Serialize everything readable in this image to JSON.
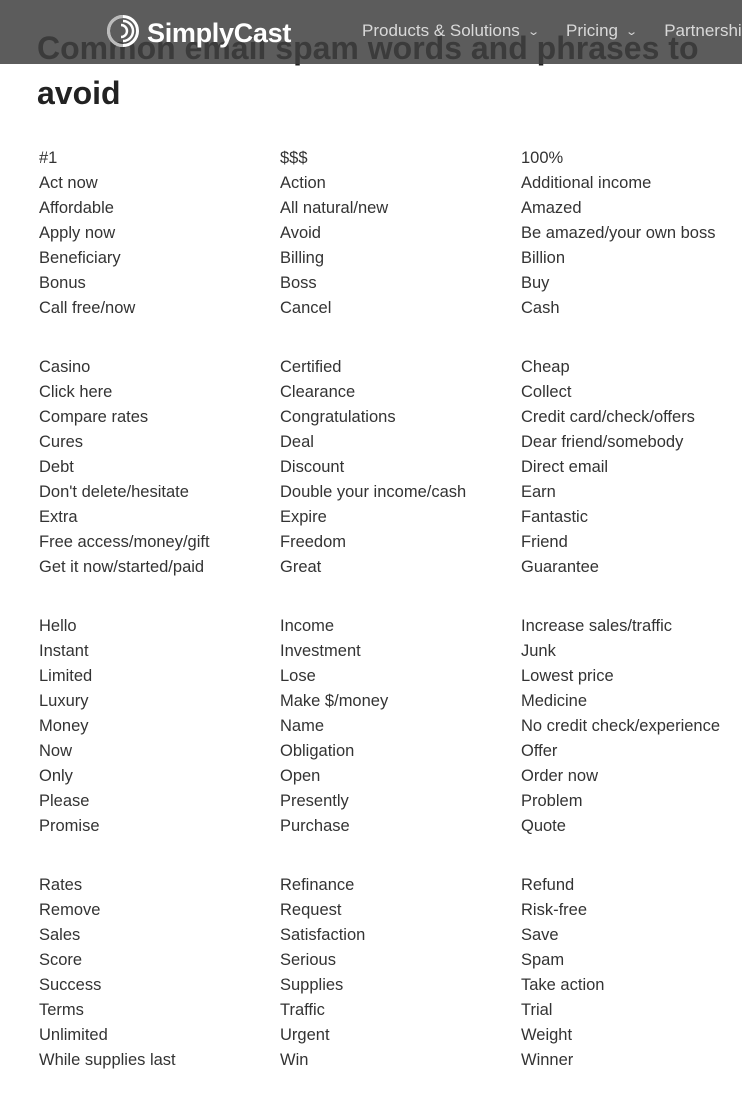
{
  "header": {
    "brand": "SimplyCast",
    "logo_icon": "simplycast-logo-icon",
    "nav": [
      {
        "label": "Products & Solutions",
        "has_dropdown": true
      },
      {
        "label": "Pricing",
        "has_dropdown": true
      },
      {
        "label": "Partnerships",
        "has_dropdown": false
      }
    ],
    "chevron": "⌄"
  },
  "title": "Common email spam words and phrases to avoid",
  "groups": [
    [
      [
        "#1",
        "$$$",
        "100%"
      ],
      [
        "Act now",
        "Action",
        "Additional income"
      ],
      [
        "Affordable",
        "All natural/new",
        "Amazed"
      ],
      [
        "Apply now",
        "Avoid",
        "Be amazed/your own boss"
      ],
      [
        "Beneficiary",
        "Billing",
        "Billion"
      ],
      [
        "Bonus",
        "Boss",
        "Buy"
      ],
      [
        "Call free/now",
        "Cancel",
        "Cash"
      ]
    ],
    [
      [
        "Casino",
        "Certified",
        "Cheap"
      ],
      [
        "Click here",
        "Clearance",
        "Collect"
      ],
      [
        "Compare rates",
        "Congratulations",
        "Credit card/check/offers"
      ],
      [
        "Cures",
        "Deal",
        "Dear friend/somebody"
      ],
      [
        "Debt",
        "Discount",
        "Direct email"
      ],
      [
        "Don't delete/hesitate",
        "Double your income/cash",
        "Earn"
      ],
      [
        "Extra",
        "Expire",
        "Fantastic"
      ],
      [
        "Free access/money/gift",
        "Freedom",
        "Friend"
      ],
      [
        "Get it now/started/paid",
        "Great",
        "Guarantee"
      ]
    ],
    [
      [
        "Hello",
        "Income",
        "Increase sales/traffic"
      ],
      [
        "Instant",
        "Investment",
        "Junk"
      ],
      [
        "Limited",
        "Lose",
        "Lowest price"
      ],
      [
        "Luxury",
        "Make $/money",
        "Medicine"
      ],
      [
        "Money",
        "Name",
        "No credit check/experience"
      ],
      [
        "Now",
        "Obligation",
        "Offer"
      ],
      [
        "Only",
        "Open",
        "Order now"
      ],
      [
        "Please",
        "Presently",
        "Problem"
      ],
      [
        "Promise",
        "Purchase",
        "Quote"
      ]
    ],
    [
      [
        "Rates",
        "Refinance",
        "Refund"
      ],
      [
        "Remove",
        "Request",
        "Risk-free"
      ],
      [
        "Sales",
        "Satisfaction",
        "Save"
      ],
      [
        "Score",
        "Serious",
        "Spam"
      ],
      [
        "Success",
        "Supplies",
        "Take action"
      ],
      [
        "Terms",
        "Traffic",
        "Trial"
      ],
      [
        "Unlimited",
        "Urgent",
        "Weight"
      ],
      [
        "While supplies last",
        "Win",
        "Winner"
      ]
    ]
  ]
}
